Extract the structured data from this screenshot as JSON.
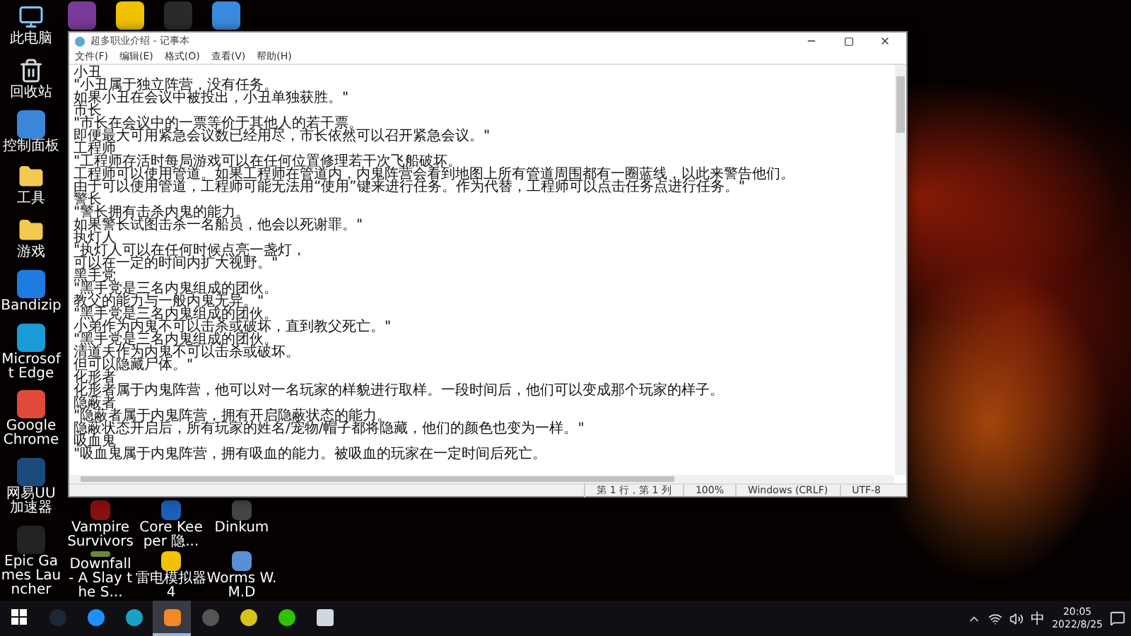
{
  "desktop": {
    "left_column": [
      {
        "label": "此电脑"
      },
      {
        "label": "回收站"
      },
      {
        "label": "控制面板"
      },
      {
        "label": "工具"
      },
      {
        "label": "游戏"
      },
      {
        "label": "Bandizip"
      },
      {
        "label": "Microsoft Edge"
      },
      {
        "label": "Google Chrome"
      },
      {
        "label": "网易UU加速器"
      },
      {
        "label": "Epic Games Launcher"
      }
    ],
    "bottom_icons": [
      {
        "label": "Vampire Survivors"
      },
      {
        "label": "Core Keeper 隐..."
      },
      {
        "label": "Dinkum"
      },
      {
        "label": "Downfall - A Slay the S..."
      },
      {
        "label": "雷电模拟器4"
      },
      {
        "label": "Worms W.M.D"
      }
    ]
  },
  "notepad": {
    "title": "超多职业介绍 - 记事本",
    "menu": [
      "文件(F)",
      "编辑(E)",
      "格式(O)",
      "查看(V)",
      "帮助(H)"
    ],
    "lines": [
      "小丑",
      "\"小丑属于独立阵营，没有任务。",
      "如果小丑在会议中被投出，小丑单独获胜。\"",
      "市长",
      "\"市长在会议中的一票等价于其他人的若干票。",
      "即便最大可用紧急会议数已经用尽，市长依然可以召开紧急会议。\"",
      "工程师",
      "\"工程师存活时每局游戏可以在任何位置修理若干次飞船破坏。",
      "工程师可以使用管道。如果工程师在管道内，内鬼阵营会看到地图上所有管道周围都有一圈蓝线，以此来警告他们。",
      "由于可以使用管道，工程师可能无法用“使用”键来进行任务。作为代替，工程师可以点击任务点进行任务。\"",
      "警长",
      "\"警长拥有击杀内鬼的能力。",
      "如果警长试图击杀一名船员，他会以死谢罪。\"",
      "执灯人",
      "\"执灯人可以在任何时候点亮一盏灯，",
      "可以在一定的时间内扩大视野。\"",
      "黑手党",
      "\"黑手党是三名内鬼组成的团伙。",
      "教父的能力与一般内鬼无异。\"",
      "\"黑手党是三名内鬼组成的团伙。",
      "小弟作为内鬼不可以击杀或破坏，直到教父死亡。\"",
      "\"黑手党是三名内鬼组成的团伙。",
      "清道夫作为内鬼不可以击杀或破坏。",
      "但可以隐藏尸体。\"",
      "化形者",
      "化形者属于内鬼阵营，他可以对一名玩家的样貌进行取样。一段时间后，他们可以变成那个玩家的样子。",
      "隐蔽者",
      "\"隐蔽者属于内鬼阵营，拥有开启隐蔽状态的能力。",
      "隐蔽状态开启后，所有玩家的姓名/宠物/帽子都将隐藏，他们的颜色也变为一样。\"",
      "吸血鬼",
      "\"吸血鬼属于内鬼阵营，拥有吸血的能力。被吸血的玩家在一定时间后死亡。"
    ],
    "status": [
      "第 1 行，第 1 列",
      "100%",
      "Windows (CRLF)",
      "UTF-8"
    ]
  },
  "taskbar": {
    "apps": [
      {
        "selected": false
      },
      {
        "selected": false
      },
      {
        "selected": false
      },
      {
        "selected": true
      },
      {
        "selected": false
      },
      {
        "selected": false
      },
      {
        "selected": false
      },
      {
        "selected": false
      }
    ],
    "ime": "中",
    "time": "20:05",
    "date": "2022/8/25"
  }
}
